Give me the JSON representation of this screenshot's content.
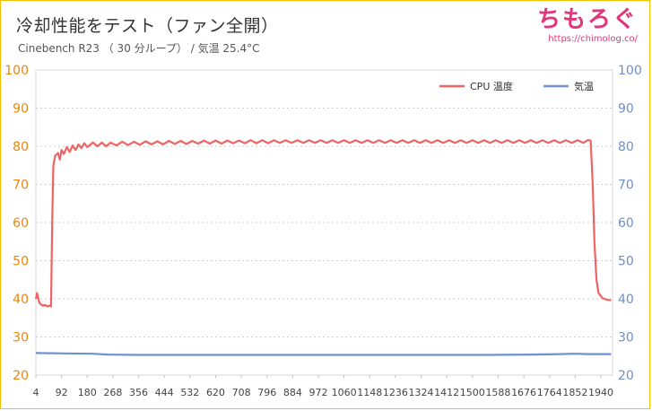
{
  "header": {
    "title": "冷却性能をテスト（ファン全開）",
    "subtitle": "Cinebench R23 （ 30 分ループ） /  気温 25.4°C",
    "brand": "ちもろぐ",
    "brand_url": "https://chimolog.co/"
  },
  "chart_data": {
    "type": "line",
    "title": "",
    "xlabel": "",
    "ylabel": "",
    "xlim": [
      4,
      1980
    ],
    "ylim": [
      20,
      100
    ],
    "yticks": [
      20,
      30,
      40,
      50,
      60,
      70,
      80,
      90,
      100
    ],
    "xticks": [
      4,
      92,
      180,
      268,
      356,
      444,
      532,
      620,
      708,
      796,
      884,
      972,
      1060,
      1148,
      1236,
      1324,
      1412,
      1500,
      1588,
      1676,
      1764,
      1852,
      1940
    ],
    "grid": true,
    "legend_position": "top-right",
    "left_axis_color": "#e8850c",
    "right_axis_color": "#6f8fc4",
    "series": [
      {
        "name": "CPU 温度",
        "color": "#ee6464",
        "points": [
          [
            4,
            40
          ],
          [
            8,
            41.5
          ],
          [
            12,
            40.2
          ],
          [
            16,
            39
          ],
          [
            22,
            38.5
          ],
          [
            28,
            38.2
          ],
          [
            36,
            38.4
          ],
          [
            44,
            38
          ],
          [
            50,
            38.2
          ],
          [
            56,
            38
          ],
          [
            60,
            60
          ],
          [
            64,
            75
          ],
          [
            70,
            77.5
          ],
          [
            80,
            78.2
          ],
          [
            86,
            76.5
          ],
          [
            92,
            79
          ],
          [
            100,
            78
          ],
          [
            110,
            79.8
          ],
          [
            120,
            78.5
          ],
          [
            130,
            80.2
          ],
          [
            140,
            79
          ],
          [
            150,
            80.5
          ],
          [
            160,
            79.5
          ],
          [
            170,
            80.8
          ],
          [
            180,
            79.8
          ],
          [
            200,
            81
          ],
          [
            215,
            80
          ],
          [
            230,
            81
          ],
          [
            245,
            80
          ],
          [
            260,
            81
          ],
          [
            280,
            80.2
          ],
          [
            300,
            81.2
          ],
          [
            320,
            80.3
          ],
          [
            340,
            81.2
          ],
          [
            360,
            80.4
          ],
          [
            380,
            81.3
          ],
          [
            400,
            80.5
          ],
          [
            420,
            81.3
          ],
          [
            440,
            80.5
          ],
          [
            460,
            81.4
          ],
          [
            480,
            80.6
          ],
          [
            500,
            81.4
          ],
          [
            520,
            80.6
          ],
          [
            540,
            81.4
          ],
          [
            560,
            80.7
          ],
          [
            580,
            81.5
          ],
          [
            600,
            80.7
          ],
          [
            620,
            81.5
          ],
          [
            640,
            80.7
          ],
          [
            660,
            81.5
          ],
          [
            680,
            80.8
          ],
          [
            700,
            81.5
          ],
          [
            720,
            80.8
          ],
          [
            740,
            81.6
          ],
          [
            760,
            80.8
          ],
          [
            780,
            81.6
          ],
          [
            800,
            80.8
          ],
          [
            820,
            81.6
          ],
          [
            840,
            80.9
          ],
          [
            860,
            81.6
          ],
          [
            880,
            80.9
          ],
          [
            900,
            81.6
          ],
          [
            920,
            80.9
          ],
          [
            940,
            81.6
          ],
          [
            960,
            80.9
          ],
          [
            980,
            81.6
          ],
          [
            1000,
            80.9
          ],
          [
            1020,
            81.6
          ],
          [
            1040,
            80.9
          ],
          [
            1060,
            81.6
          ],
          [
            1080,
            80.9
          ],
          [
            1100,
            81.6
          ],
          [
            1120,
            80.9
          ],
          [
            1140,
            81.6
          ],
          [
            1160,
            80.9
          ],
          [
            1180,
            81.6
          ],
          [
            1200,
            80.9
          ],
          [
            1220,
            81.6
          ],
          [
            1240,
            80.9
          ],
          [
            1260,
            81.6
          ],
          [
            1280,
            80.9
          ],
          [
            1300,
            81.6
          ],
          [
            1320,
            80.9
          ],
          [
            1340,
            81.6
          ],
          [
            1360,
            80.9
          ],
          [
            1380,
            81.6
          ],
          [
            1400,
            80.9
          ],
          [
            1420,
            81.6
          ],
          [
            1440,
            80.9
          ],
          [
            1460,
            81.6
          ],
          [
            1480,
            80.9
          ],
          [
            1500,
            81.6
          ],
          [
            1520,
            80.9
          ],
          [
            1540,
            81.6
          ],
          [
            1560,
            80.9
          ],
          [
            1580,
            81.6
          ],
          [
            1600,
            80.9
          ],
          [
            1620,
            81.6
          ],
          [
            1640,
            80.9
          ],
          [
            1660,
            81.6
          ],
          [
            1680,
            80.9
          ],
          [
            1700,
            81.6
          ],
          [
            1720,
            80.9
          ],
          [
            1740,
            81.6
          ],
          [
            1760,
            80.9
          ],
          [
            1780,
            81.6
          ],
          [
            1800,
            80.9
          ],
          [
            1820,
            81.6
          ],
          [
            1840,
            80.9
          ],
          [
            1860,
            81.6
          ],
          [
            1880,
            80.9
          ],
          [
            1895,
            81.6
          ],
          [
            1905,
            81.5
          ],
          [
            1912,
            70
          ],
          [
            1918,
            55
          ],
          [
            1925,
            45
          ],
          [
            1932,
            41.5
          ],
          [
            1945,
            40.2
          ],
          [
            1960,
            39.8
          ],
          [
            1975,
            39.6
          ]
        ]
      },
      {
        "name": "気温",
        "color": "#6f8fd6",
        "points": [
          [
            4,
            25.8
          ],
          [
            100,
            25.7
          ],
          [
            200,
            25.6
          ],
          [
            250,
            25.4
          ],
          [
            350,
            25.3
          ],
          [
            500,
            25.3
          ],
          [
            650,
            25.3
          ],
          [
            800,
            25.3
          ],
          [
            950,
            25.3
          ],
          [
            1100,
            25.3
          ],
          [
            1250,
            25.3
          ],
          [
            1400,
            25.3
          ],
          [
            1550,
            25.3
          ],
          [
            1700,
            25.4
          ],
          [
            1800,
            25.5
          ],
          [
            1850,
            25.6
          ],
          [
            1900,
            25.5
          ],
          [
            1975,
            25.5
          ]
        ]
      }
    ]
  }
}
